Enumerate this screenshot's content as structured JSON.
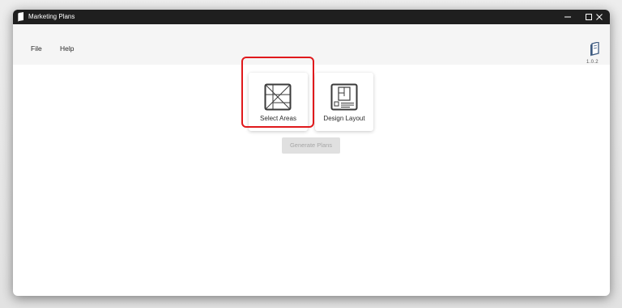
{
  "window": {
    "title": "Marketing Plans",
    "controls": {
      "minimize": "—",
      "maximize": "☐",
      "close": "✕"
    }
  },
  "menu": {
    "items": [
      "File",
      "Help"
    ]
  },
  "version": {
    "label": "1.0.2",
    "icon": "app-logo-icon"
  },
  "cards": [
    {
      "label": "Select Areas",
      "icon": "select-areas-icon",
      "highlighted": true
    },
    {
      "label": "Design Layout",
      "icon": "design-layout-icon",
      "highlighted": false
    }
  ],
  "actions": {
    "generate_label": "Generate Plans",
    "generate_enabled": false
  },
  "colors": {
    "titlebar": "#1f1f1f",
    "menubar": "#f5f5f5",
    "highlight": "#e0191c",
    "disabled_button": "#e0e0e0"
  }
}
